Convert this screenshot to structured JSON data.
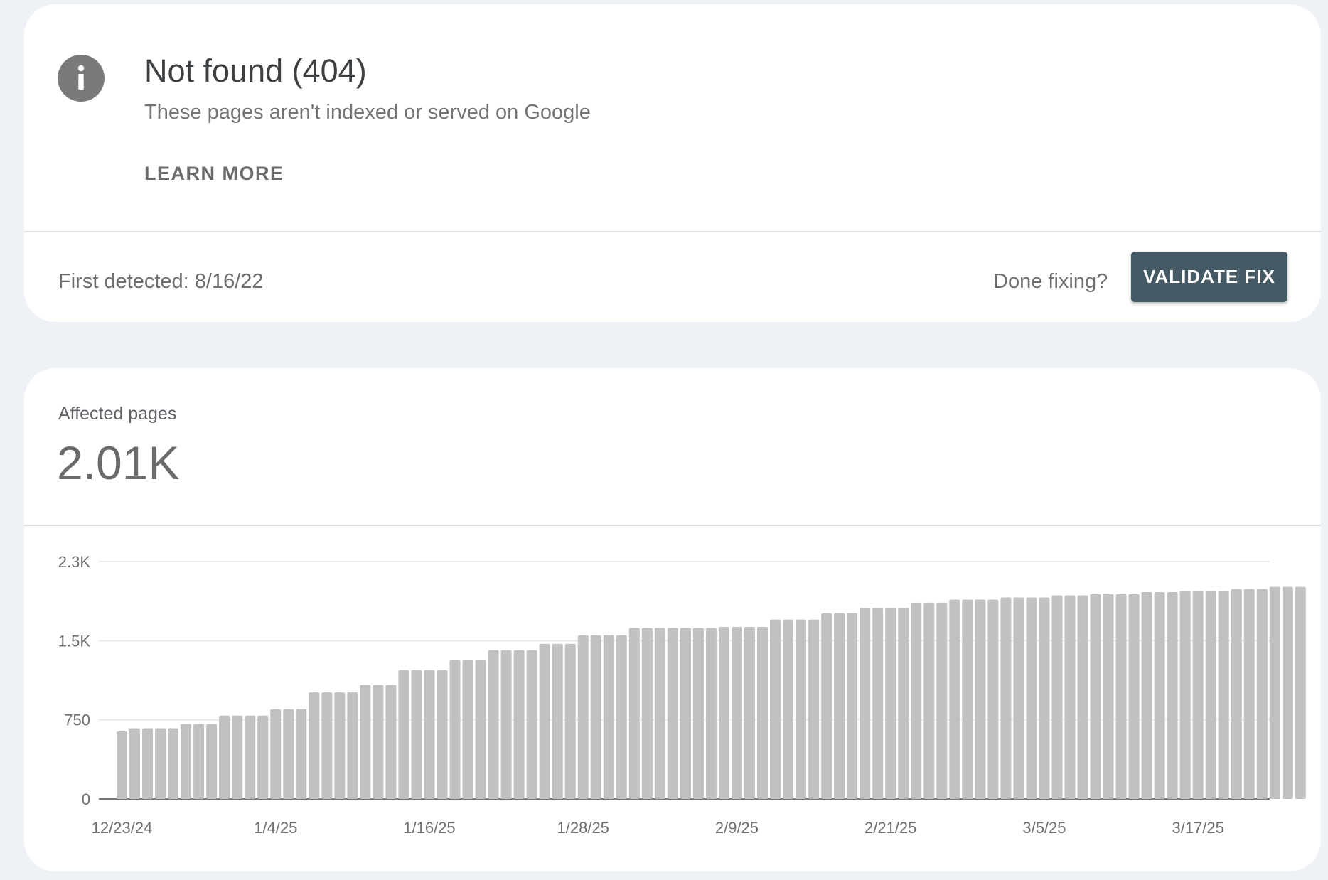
{
  "issue": {
    "title": "Not found (404)",
    "subtitle": "These pages aren't indexed or served on Google",
    "learn_more": "LEARN MORE",
    "first_detected": "First detected: 8/16/22",
    "done_fixing": "Done fixing?",
    "validate_fix": "VALIDATE FIX",
    "icon": "info-icon"
  },
  "metric": {
    "label": "Affected pages",
    "value": "2.01K"
  },
  "colors": {
    "bar": "#c1c1c1",
    "button": "#455a64",
    "background": "#eef2f7"
  },
  "chart_data": {
    "type": "bar",
    "x_labels": [
      "12/23/24",
      "1/4/25",
      "1/16/25",
      "1/28/25",
      "2/9/25",
      "2/21/25",
      "3/5/25",
      "3/17/25"
    ],
    "y_ticks": [
      "0",
      "750",
      "1.5K",
      "2.3K"
    ],
    "y_tick_values": [
      0,
      750,
      1500,
      2250
    ],
    "ylim": [
      0,
      2250
    ],
    "grid": true,
    "start_date": "12/23/24",
    "values": [
      640,
      670,
      670,
      670,
      670,
      710,
      710,
      710,
      790,
      790,
      790,
      790,
      850,
      850,
      850,
      1010,
      1010,
      1010,
      1010,
      1080,
      1080,
      1080,
      1220,
      1220,
      1220,
      1220,
      1320,
      1320,
      1320,
      1410,
      1410,
      1410,
      1410,
      1470,
      1470,
      1470,
      1550,
      1550,
      1550,
      1550,
      1620,
      1620,
      1620,
      1620,
      1620,
      1620,
      1620,
      1630,
      1630,
      1630,
      1630,
      1700,
      1700,
      1700,
      1700,
      1760,
      1760,
      1760,
      1810,
      1810,
      1810,
      1810,
      1860,
      1860,
      1860,
      1890,
      1890,
      1890,
      1890,
      1910,
      1910,
      1910,
      1910,
      1930,
      1930,
      1930,
      1940,
      1940,
      1940,
      1940,
      1960,
      1960,
      1960,
      1970,
      1970,
      1970,
      1970,
      1990,
      1990,
      1990,
      2010,
      2010,
      2010
    ]
  }
}
